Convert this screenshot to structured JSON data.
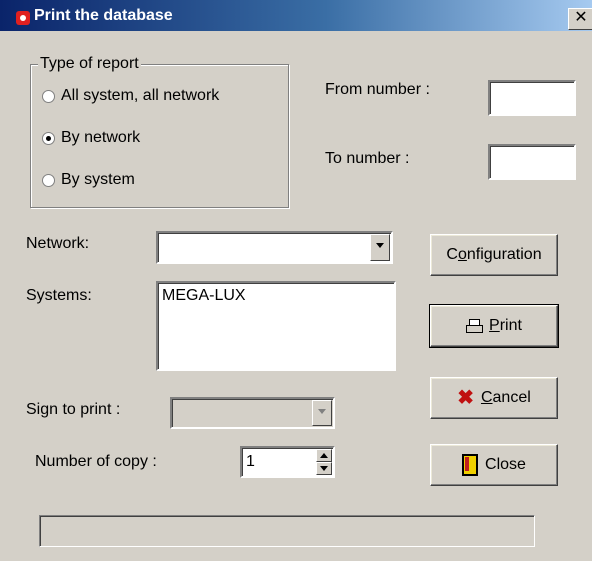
{
  "window": {
    "title": "Print the database",
    "close_glyph": "✕"
  },
  "report_type": {
    "legend": "Type of report",
    "options": [
      {
        "label": "All system, all network",
        "selected": false
      },
      {
        "label": "By network",
        "selected": true
      },
      {
        "label": "By system",
        "selected": false
      }
    ]
  },
  "range": {
    "from_label": "From number :",
    "from_value": "",
    "to_label": "To number :",
    "to_value": ""
  },
  "network": {
    "label": "Network:",
    "value": ""
  },
  "systems": {
    "label": "Systems:",
    "items": [
      "MEGA-LUX"
    ]
  },
  "sign": {
    "label": "Sign to print :",
    "value": ""
  },
  "copies": {
    "label": "Number of copy :",
    "value": "1"
  },
  "buttons": {
    "configuration": {
      "pre": "C",
      "mnemonic": "o",
      "post": "nfiguration"
    },
    "print": {
      "pre": "",
      "mnemonic": "P",
      "post": "rint",
      "icon": "printer-icon"
    },
    "cancel": {
      "pre": "",
      "mnemonic": "C",
      "post": "ancel",
      "icon": "cancel-x-icon"
    },
    "close": {
      "label": "Close",
      "icon": "door-exit-icon"
    }
  },
  "status_bar": {
    "text": ""
  }
}
